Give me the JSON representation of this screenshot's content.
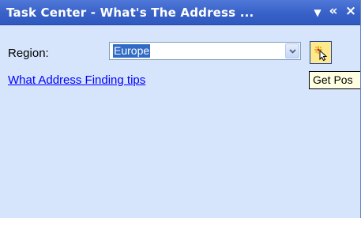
{
  "pane": {
    "title": "Task Center - What's The Address ...",
    "menu_icon": "dropdown-arrow-icon",
    "collapse_icon": "double-chevron-left-icon",
    "close_icon": "close-icon",
    "collapse_glyph": "«",
    "close_glyph": "×",
    "menu_glyph": "▼"
  },
  "form": {
    "region_label": "Region:",
    "region_value": "Europe",
    "get_position_icon": "magic-wand-cursor-icon",
    "tips_link": "What Address Finding tips"
  },
  "tooltip": {
    "text": "Get Pos"
  },
  "colors": {
    "title_bar": "#3a63c9",
    "pane_background": "#d6e4fc",
    "selection": "#316ac5",
    "button_highlight": "#ffe98d",
    "link": "#0000ff",
    "tooltip_background": "#ffffe1"
  }
}
